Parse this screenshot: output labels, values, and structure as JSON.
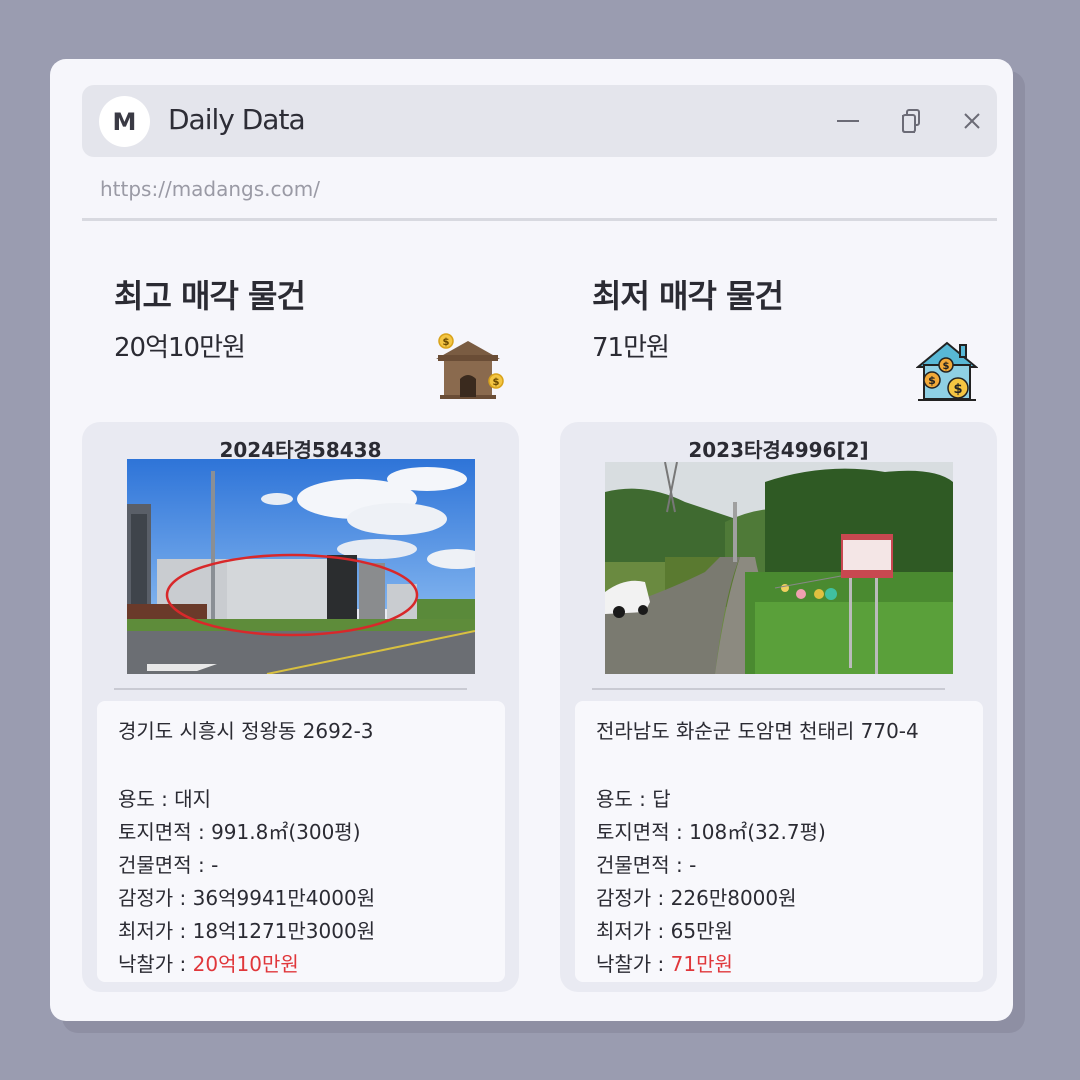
{
  "app": {
    "avatar_letter": "M",
    "title": "Daily Data",
    "url": "https://madangs.com/"
  },
  "highest": {
    "heading": "최고 매각 물건",
    "amount": "20억10만원",
    "case_no": "2024타경58438",
    "address": "경기도 시흥시 정왕동 2692-3",
    "rows": [
      {
        "label": "용도 : ",
        "value": "대지"
      },
      {
        "label": "토지면적 : ",
        "value": "991.8㎡(300평)"
      },
      {
        "label": "건물면적 : ",
        "value": "-"
      },
      {
        "label": "감정가 : ",
        "value": "36억9941만4000원"
      },
      {
        "label": "최저가 : ",
        "value": "18억1271만3000원"
      },
      {
        "label": "낙찰가 : ",
        "value": "20억10만원"
      }
    ]
  },
  "lowest": {
    "heading": "최저 매각 물건",
    "amount": "71만원",
    "case_no": "2023타경4996[2]",
    "address": "전라남도 화순군 도암면 천태리 770-4",
    "rows": [
      {
        "label": "용도 : ",
        "value": " 답"
      },
      {
        "label": "토지면적 : ",
        "value": "108㎡(32.7평)"
      },
      {
        "label": "건물면적 : ",
        "value": "-"
      },
      {
        "label": "감정가 : ",
        "value": "226만8000원"
      },
      {
        "label": "최저가 : ",
        "value": "65만원"
      },
      {
        "label": "낙찰가 : ",
        "value": "71만원"
      }
    ]
  },
  "icons": {
    "minimize": "minimize-icon",
    "copy": "copy-icon",
    "close": "close-icon",
    "house_money_left": "house-money-icon",
    "house_money_right": "house-coins-icon"
  },
  "colors": {
    "accent_red": "#e0373b",
    "background": "#9a9cb0",
    "window": "#f6f6fb"
  }
}
